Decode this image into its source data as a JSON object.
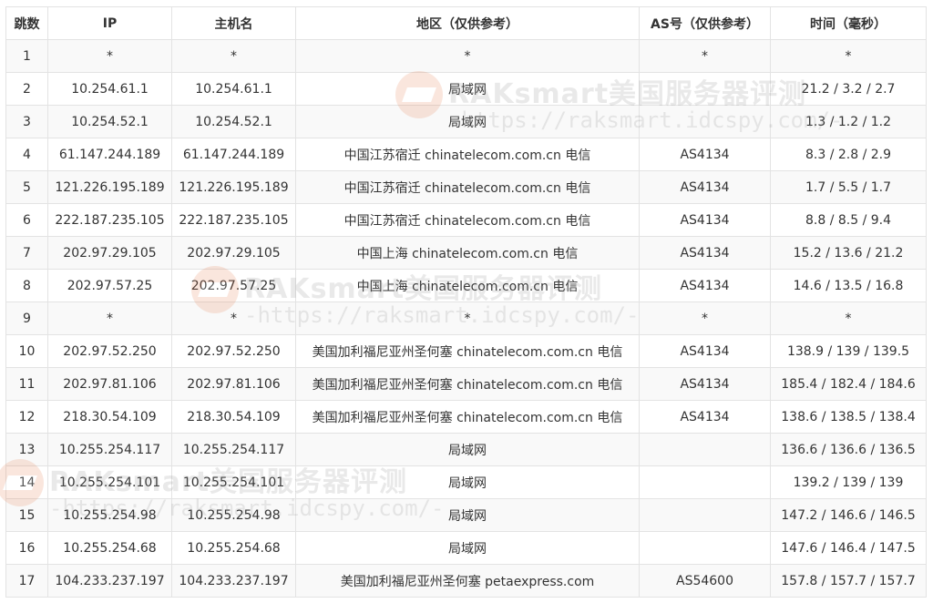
{
  "headers": {
    "hop": "跳数",
    "ip": "IP",
    "host": "主机名",
    "region": "地区（仅供参考）",
    "as": "AS号（仅供参考）",
    "time": "时间（毫秒）"
  },
  "rows": [
    {
      "hop": "1",
      "ip": "*",
      "host": "*",
      "region": "*",
      "as": "*",
      "time": "*"
    },
    {
      "hop": "2",
      "ip": "10.254.61.1",
      "host": "10.254.61.1",
      "region": "局域网",
      "as": "",
      "time": "21.2 / 3.2 / 2.7"
    },
    {
      "hop": "3",
      "ip": "10.254.52.1",
      "host": "10.254.52.1",
      "region": "局域网",
      "as": "",
      "time": "1.3 / 1.2 / 1.2"
    },
    {
      "hop": "4",
      "ip": "61.147.244.189",
      "host": "61.147.244.189",
      "region": "中国江苏宿迁 chinatelecom.com.cn 电信",
      "as": "AS4134",
      "time": "8.3 / 2.8 / 2.9"
    },
    {
      "hop": "5",
      "ip": "121.226.195.189",
      "host": "121.226.195.189",
      "region": "中国江苏宿迁 chinatelecom.com.cn 电信",
      "as": "AS4134",
      "time": "1.7 / 5.5 / 1.7"
    },
    {
      "hop": "6",
      "ip": "222.187.235.105",
      "host": "222.187.235.105",
      "region": "中国江苏宿迁 chinatelecom.com.cn 电信",
      "as": "AS4134",
      "time": "8.8 / 8.5 / 9.4"
    },
    {
      "hop": "7",
      "ip": "202.97.29.105",
      "host": "202.97.29.105",
      "region": "中国上海 chinatelecom.com.cn 电信",
      "as": "AS4134",
      "time": "15.2 / 13.6 / 21.2"
    },
    {
      "hop": "8",
      "ip": "202.97.57.25",
      "host": "202.97.57.25",
      "region": "中国上海 chinatelecom.com.cn 电信",
      "as": "AS4134",
      "time": "14.6 / 13.5 / 16.8"
    },
    {
      "hop": "9",
      "ip": "*",
      "host": "*",
      "region": "*",
      "as": "*",
      "time": "*"
    },
    {
      "hop": "10",
      "ip": "202.97.52.250",
      "host": "202.97.52.250",
      "region": "美国加利福尼亚州圣何塞 chinatelecom.com.cn 电信",
      "as": "AS4134",
      "time": "138.9 / 139 / 139.5"
    },
    {
      "hop": "11",
      "ip": "202.97.81.106",
      "host": "202.97.81.106",
      "region": "美国加利福尼亚州圣何塞 chinatelecom.com.cn 电信",
      "as": "AS4134",
      "time": "185.4 / 182.4 / 184.6"
    },
    {
      "hop": "12",
      "ip": "218.30.54.109",
      "host": "218.30.54.109",
      "region": "美国加利福尼亚州圣何塞 chinatelecom.com.cn 电信",
      "as": "AS4134",
      "time": "138.6 / 138.5 / 138.4"
    },
    {
      "hop": "13",
      "ip": "10.255.254.117",
      "host": "10.255.254.117",
      "region": "局域网",
      "as": "",
      "time": "136.6 / 136.6 / 136.5"
    },
    {
      "hop": "14",
      "ip": "10.255.254.101",
      "host": "10.255.254.101",
      "region": "局域网",
      "as": "",
      "time": "139.2 / 139 / 139"
    },
    {
      "hop": "15",
      "ip": "10.255.254.98",
      "host": "10.255.254.98",
      "region": "局域网",
      "as": "",
      "time": "147.2 / 146.6 / 146.5"
    },
    {
      "hop": "16",
      "ip": "10.255.254.68",
      "host": "10.255.254.68",
      "region": "局域网",
      "as": "",
      "time": "147.6 / 146.4 / 147.5"
    },
    {
      "hop": "17",
      "ip": "104.233.237.197",
      "host": "104.233.237.197",
      "region": "美国加利福尼亚州圣何塞 petaexpress.com",
      "as": "AS54600",
      "time": "157.8 / 157.7 / 157.7"
    }
  ],
  "watermark": {
    "title": "RAKsmart美国服务器评测",
    "url": "-https://raksmart.idcspy.com/-"
  },
  "colors": {
    "link": "#2f6fb3",
    "stripe": "#f9f9f9",
    "border": "#e3e3e3"
  }
}
